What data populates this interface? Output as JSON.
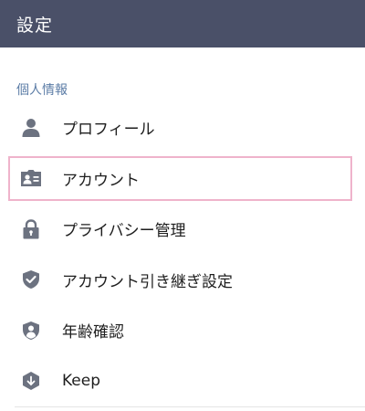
{
  "header": {
    "title": "設定"
  },
  "section": {
    "label": "個人情報"
  },
  "menu": {
    "items": [
      {
        "label": "プロフィール",
        "icon": "person-icon"
      },
      {
        "label": "アカウント",
        "icon": "id-card-icon"
      },
      {
        "label": "プライバシー管理",
        "icon": "lock-icon"
      },
      {
        "label": "アカウント引き継ぎ設定",
        "icon": "shield-check-icon"
      },
      {
        "label": "年齢確認",
        "icon": "shield-person-icon"
      },
      {
        "label": "Keep",
        "icon": "keep-icon"
      }
    ]
  },
  "colors": {
    "header_bg": "#4a5068",
    "section_label": "#5b7ca6",
    "icon_gray": "#6c7280",
    "highlight_border": "#efb3cb"
  }
}
